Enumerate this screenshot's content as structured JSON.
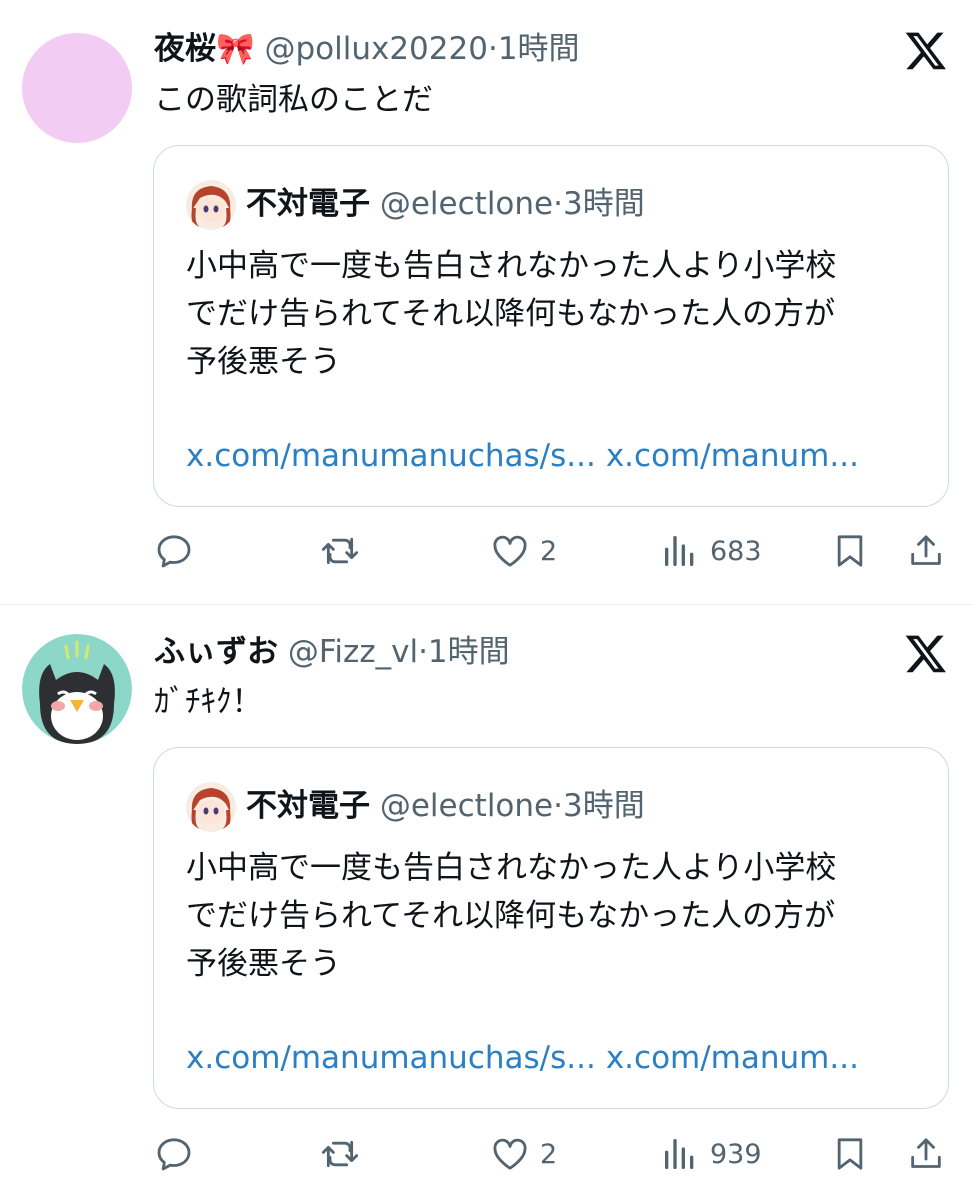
{
  "tweets": [
    {
      "name": "夜桜🎀",
      "handle": "@pollux20220",
      "time": "1時間",
      "text": "この歌詞私のことだ",
      "quote": {
        "name": "不対電子",
        "handle": "@electlone",
        "time": "3時間",
        "lines": [
          "小中高で一度も告白されなかった人より小学校",
          "でだけ告られてそれ以降何もなかった人の方が",
          "予後悪そう"
        ],
        "link1": "x.com/manumanuchas/s...",
        "link2": "x.com/manum..."
      },
      "likes": "2",
      "views": "683"
    },
    {
      "name": "ふぃずお",
      "handle": "@Fizz_vl",
      "time": "1時間",
      "text": "ｶﾞﾁｷｸ！",
      "quote": {
        "name": "不対電子",
        "handle": "@electlone",
        "time": "3時間",
        "lines": [
          "小中高で一度も告白されなかった人より小学校",
          "でだけ告られてそれ以降何もなかった人の方が",
          "予後悪そう"
        ],
        "link1": "x.com/manumanuchas/s...",
        "link2": "x.com/manum..."
      },
      "likes": "2",
      "views": "939"
    }
  ],
  "separator": "·",
  "icons": [
    "reply-icon",
    "retweet-icon",
    "like-icon",
    "views-icon",
    "bookmark-icon",
    "share-icon",
    "x-logo-icon"
  ],
  "colors": {
    "text": "#0f1419",
    "secondary": "#536471",
    "link": "#2b7fc4",
    "border": "#cfd9de",
    "avatar1": "#f0c8f0"
  }
}
